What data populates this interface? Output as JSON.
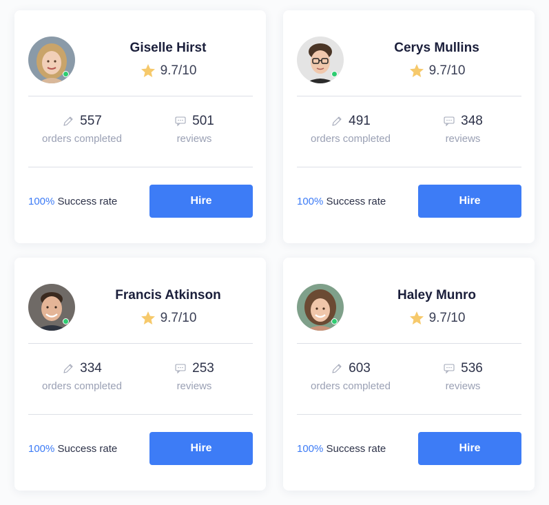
{
  "cards": [
    {
      "name": "Giselle Hirst",
      "rating": "9.7/10",
      "orders_count": "557",
      "orders_label": "orders completed",
      "reviews_count": "501",
      "reviews_label": "reviews",
      "success_pct": "100%",
      "success_label": "Success rate",
      "hire_label": "Hire",
      "online": true
    },
    {
      "name": "Cerys Mullins",
      "rating": "9.7/10",
      "orders_count": "491",
      "orders_label": "orders completed",
      "reviews_count": "348",
      "reviews_label": "reviews",
      "success_pct": "100%",
      "success_label": "Success rate",
      "hire_label": "Hire",
      "online": true
    },
    {
      "name": "Francis Atkinson",
      "rating": "9.7/10",
      "orders_count": "334",
      "orders_label": "orders completed",
      "reviews_count": "253",
      "reviews_label": "reviews",
      "success_pct": "100%",
      "success_label": "Success rate",
      "hire_label": "Hire",
      "online": true
    },
    {
      "name": "Haley Munro",
      "rating": "9.7/10",
      "orders_count": "603",
      "orders_label": "orders completed",
      "reviews_count": "536",
      "reviews_label": "reviews",
      "success_pct": "100%",
      "success_label": "Success rate",
      "hire_label": "Hire",
      "online": true
    }
  ],
  "icons": {
    "rating": "star-icon",
    "orders": "pencil-icon",
    "reviews": "chat-icon",
    "status": "online-dot"
  },
  "colors": {
    "accent": "#3d7cf6",
    "star": "#f6c96b",
    "online": "#2ecc71",
    "muted_text": "#9aa0b4"
  }
}
